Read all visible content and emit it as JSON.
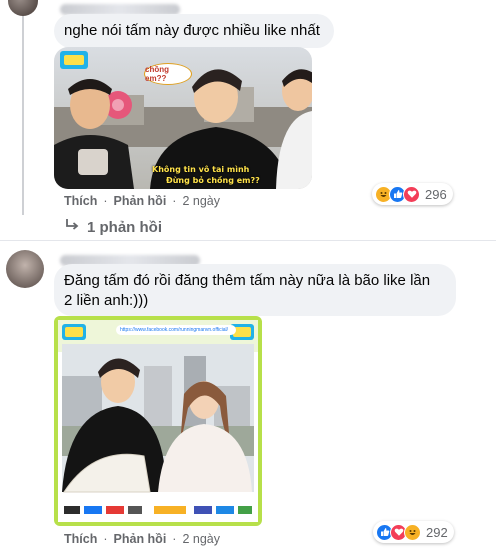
{
  "comment1": {
    "text": "nghe nói tấm này được nhiều like nhất",
    "image": {
      "speech_bubble": "chồng em??",
      "caption_line1": "Không tin vô tai mình",
      "caption_line2": "Đừng bỏ chồng em??"
    },
    "actions": {
      "like": "Thích",
      "reply": "Phản hồi",
      "time": "2 ngày",
      "sep": "·"
    },
    "reaction_count": "296",
    "reactions": [
      "haha-icon",
      "like-icon",
      "love-icon"
    ]
  },
  "replies_link": {
    "label": "1 phản hồi"
  },
  "comment2": {
    "text_line1": "Đăng tấm đó rồi đăng thêm tấm này nữa là bão like lần",
    "text_line2": "2 liền anh:)))",
    "image": {
      "url_bar": "https://www.facebook.com/runningmanvn.official/"
    },
    "actions": {
      "like": "Thích",
      "reply": "Phản hồi",
      "time": "2 ngày",
      "sep": "·"
    },
    "reaction_count": "292",
    "reactions": [
      "like-icon",
      "love-icon",
      "haha-icon"
    ]
  },
  "colors": {
    "bubble_bg": "#f0f2f5",
    "meta_text": "#65676b",
    "like_blue": "#1877f2",
    "love_red": "#f33e58",
    "haha_yellow": "#f7b125",
    "frame_green": "#b7e04a"
  }
}
